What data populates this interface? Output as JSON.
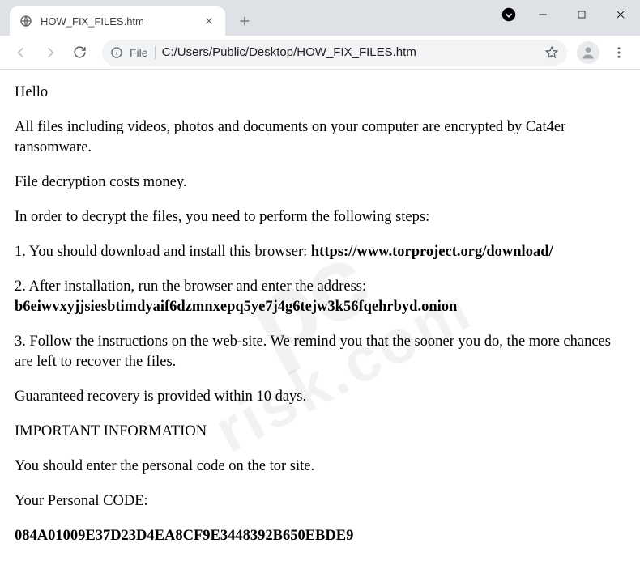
{
  "window": {
    "tab_title": "HOW_FIX_FILES.htm"
  },
  "toolbar": {
    "url_scheme_label": "File",
    "url_path": "C:/Users/Public/Desktop/HOW_FIX_FILES.htm"
  },
  "document": {
    "greeting": "Hello",
    "intro": "All files including videos, photos and documents on your computer are encrypted by Cat4er ransomware.",
    "cost": "File decryption costs money.",
    "instructions_lead": "In order to decrypt the files, you need to perform the following steps:",
    "step1_text": "1. You should download and install this browser: ",
    "step1_link": "https://www.torproject.org/download/",
    "step2_text": "2. After installation, run the browser and enter the address:",
    "step2_address": "b6eiwvxyjjsiesbtimdyaif6dzmnxepq5ye7j4g6tejw3k56fqehrbyd.onion",
    "step3": "3. Follow the instructions on the web-site. We remind you that the sooner you do, the more chances are left to recover the files.",
    "guarantee": "Guaranteed recovery is provided within 10 days.",
    "important_heading": "IMPORTANT INFORMATION",
    "enter_code_msg": "You should enter the personal code on the tor site.",
    "code_label": "Your Personal CODE:",
    "code_value": "084A01009E37D23D4EA8CF9E3448392B650EBDE9"
  },
  "watermark": {
    "line1": "pc",
    "line2": "risk.com"
  }
}
